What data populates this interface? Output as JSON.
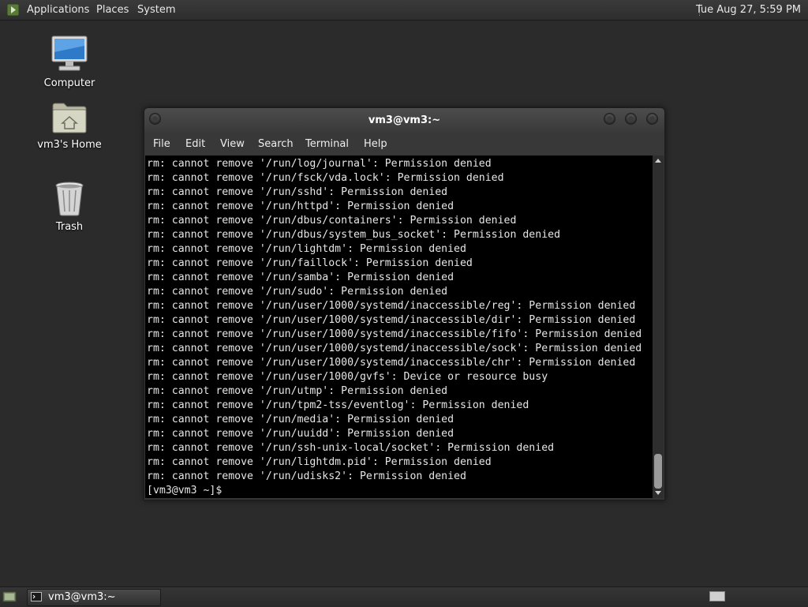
{
  "top_panel": {
    "menus": [
      "Applications",
      "Places",
      "System"
    ],
    "clock": "Tue Aug 27,  5:59 PM"
  },
  "desktop": {
    "icons": [
      {
        "label": "Computer",
        "icon": "computer-icon"
      },
      {
        "label": "vm3's Home",
        "icon": "home-folder-icon"
      },
      {
        "label": "Trash",
        "icon": "trash-icon"
      }
    ]
  },
  "window": {
    "title": "vm3@vm3:~",
    "menu": [
      "File",
      "Edit",
      "View",
      "Search",
      "Terminal",
      "Help"
    ],
    "lines": [
      "rm: cannot remove '/run/log/journal': Permission denied",
      "rm: cannot remove '/run/fsck/vda.lock': Permission denied",
      "rm: cannot remove '/run/sshd': Permission denied",
      "rm: cannot remove '/run/httpd': Permission denied",
      "rm: cannot remove '/run/dbus/containers': Permission denied",
      "rm: cannot remove '/run/dbus/system_bus_socket': Permission denied",
      "rm: cannot remove '/run/lightdm': Permission denied",
      "rm: cannot remove '/run/faillock': Permission denied",
      "rm: cannot remove '/run/samba': Permission denied",
      "rm: cannot remove '/run/sudo': Permission denied",
      "rm: cannot remove '/run/user/1000/systemd/inaccessible/reg': Permission denied",
      "rm: cannot remove '/run/user/1000/systemd/inaccessible/dir': Permission denied",
      "rm: cannot remove '/run/user/1000/systemd/inaccessible/fifo': Permission denied",
      "rm: cannot remove '/run/user/1000/systemd/inaccessible/sock': Permission denied",
      "rm: cannot remove '/run/user/1000/systemd/inaccessible/chr': Permission denied",
      "rm: cannot remove '/run/user/1000/gvfs': Device or resource busy",
      "rm: cannot remove '/run/utmp': Permission denied",
      "rm: cannot remove '/run/tpm2-tss/eventlog': Permission denied",
      "rm: cannot remove '/run/media': Permission denied",
      "rm: cannot remove '/run/uuidd': Permission denied",
      "rm: cannot remove '/run/ssh-unix-local/socket': Permission denied",
      "rm: cannot remove '/run/lightdm.pid': Permission denied",
      "rm: cannot remove '/run/udisks2': Permission denied",
      "[vm3@vm3 ~]$ "
    ]
  },
  "taskbar": {
    "task_label": "vm3@vm3:~"
  }
}
